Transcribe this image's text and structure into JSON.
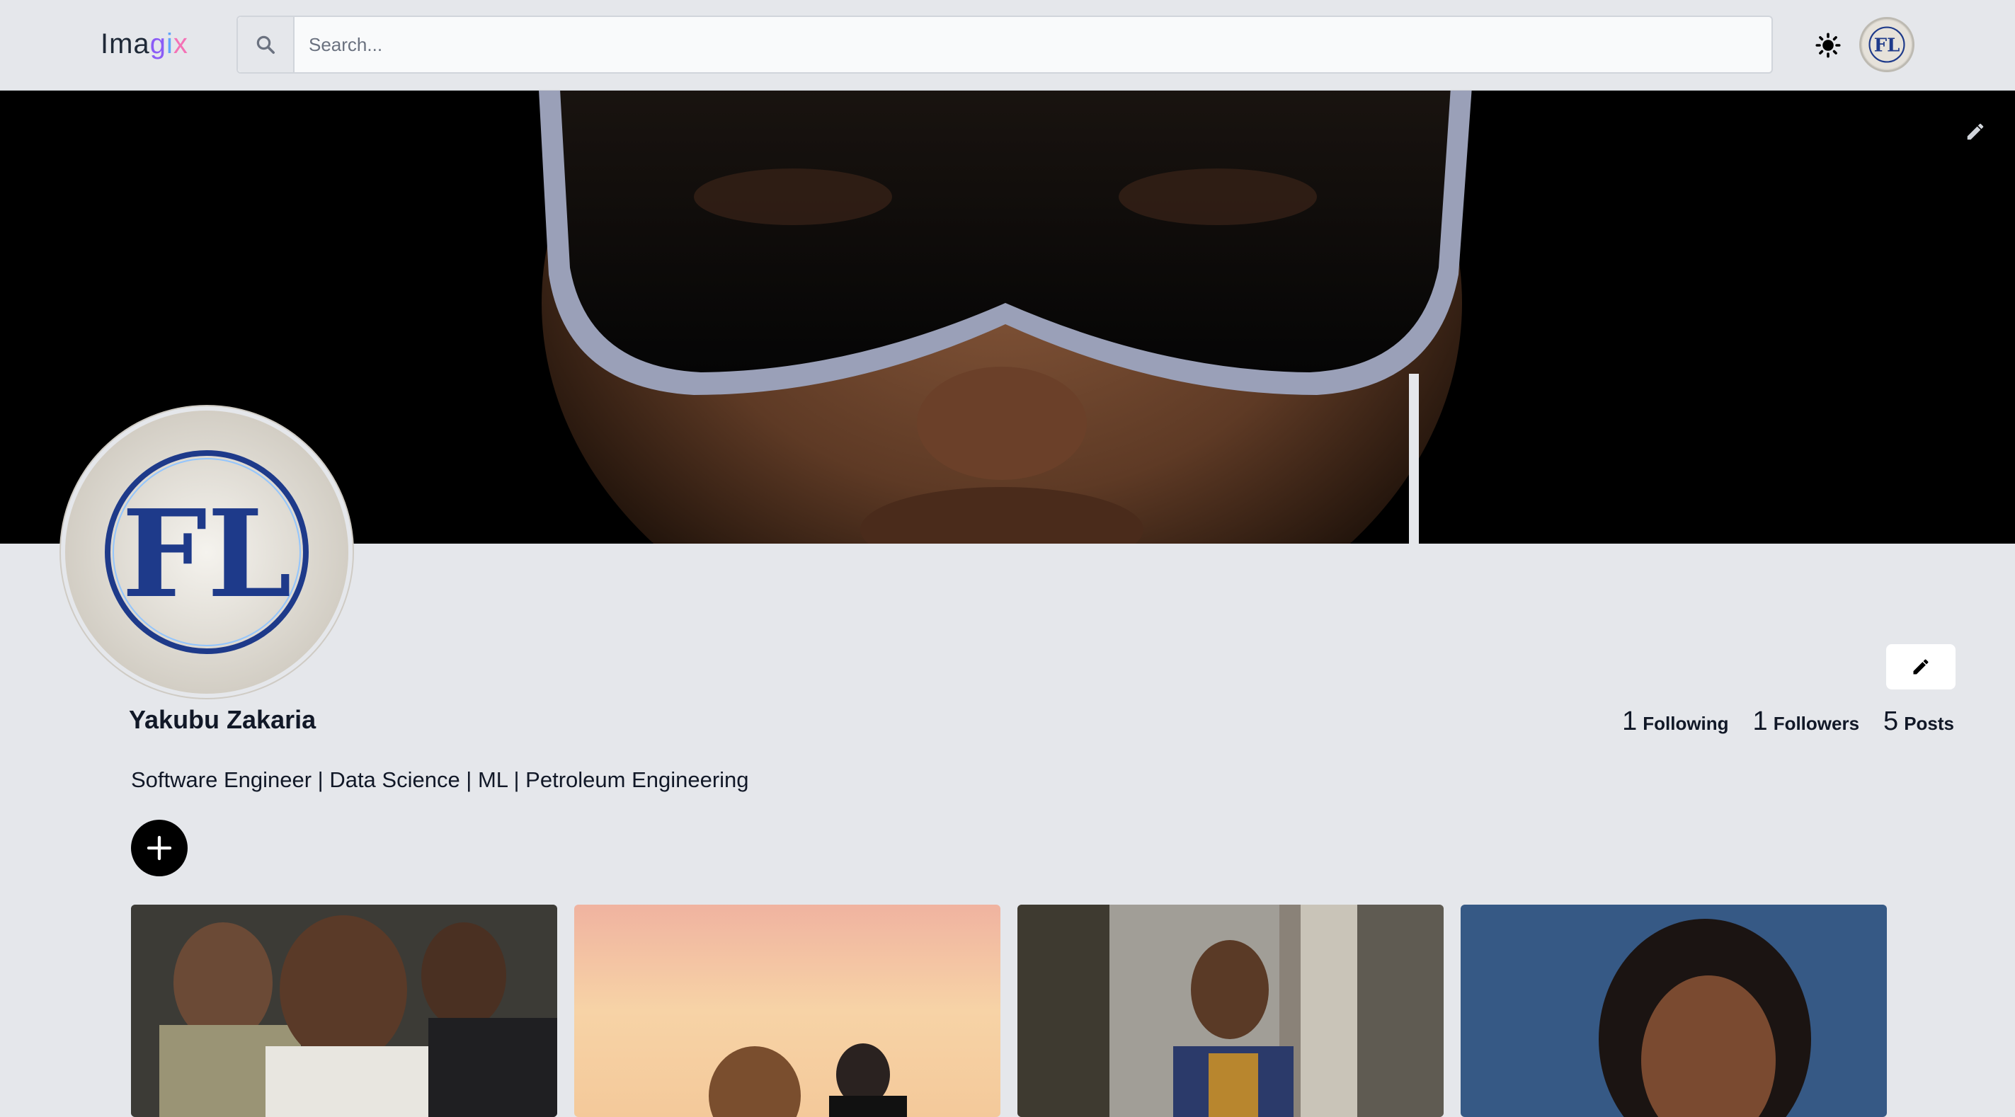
{
  "header": {
    "logo_prefix": "Ima",
    "logo_g": "g",
    "logo_i": "i",
    "logo_x": "x",
    "search_placeholder": "Search...",
    "theme_icon": "sun-icon"
  },
  "profile": {
    "name": "Yakubu Zakaria",
    "bio": "Software Engineer | Data Science | ML | Petroleum Engineering",
    "avatar_monogram": "FL"
  },
  "stats": [
    {
      "value": "1",
      "label": "Following"
    },
    {
      "value": "1",
      "label": "Followers"
    },
    {
      "value": "5",
      "label": "Posts"
    }
  ],
  "icons": {
    "cover_edit": "pencil-icon",
    "profile_edit": "pencil-icon",
    "add_post": "plus-icon",
    "search": "search-icon"
  },
  "colors": {
    "background": "#e5e7eb",
    "text": "#111827"
  }
}
